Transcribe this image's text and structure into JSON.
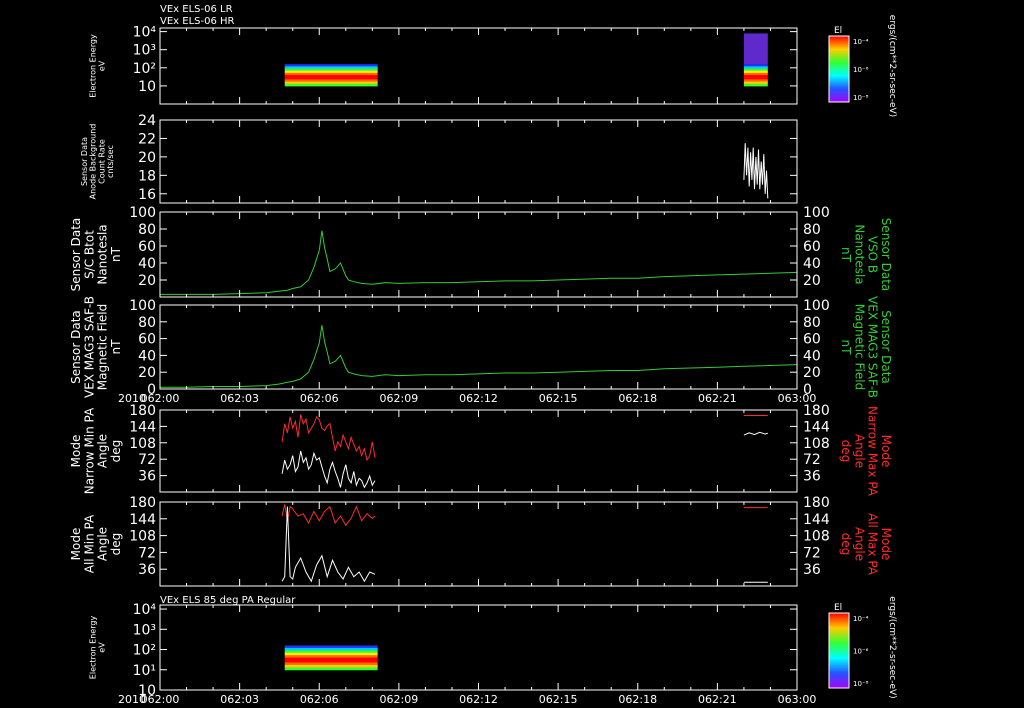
{
  "header": {
    "line1": "VEx ELS-06 LR",
    "line2": "VEx ELS-06 HR"
  },
  "colors": {
    "background": "#000000",
    "axis": "#ffffff",
    "mag": "#33cc33",
    "min_pa": "#ffffff",
    "max_pa": "#ff2a2a"
  },
  "time_axis": {
    "year": "2010",
    "ticks": [
      "062:00",
      "062:03",
      "062:06",
      "062:09",
      "062:12",
      "062:15",
      "062:18",
      "062:21",
      "063:00"
    ],
    "tick_minutes": [
      0,
      3,
      6,
      9,
      12,
      15,
      18,
      21,
      24
    ],
    "range_minutes": [
      0,
      24
    ]
  },
  "chart_data": [
    {
      "type": "heatmap",
      "id": "els_lr_hr",
      "ylabel": [
        "Electron Energy",
        "eV"
      ],
      "ytick_labels": [
        "10",
        "10²",
        "10³",
        "10⁴"
      ],
      "yticks_log10": [
        1,
        2,
        3,
        4
      ],
      "ylim_log10": [
        0,
        4.2
      ],
      "x_extent_minutes": [
        [
          4.7,
          8.2
        ],
        [
          22.0,
          22.9
        ]
      ],
      "colorbar": {
        "title": "El",
        "labels": [
          "10⁻⁴",
          "10⁻⁶",
          "10⁻⁸"
        ],
        "units": "ergs/(cm**2-sr-sec-eV)"
      }
    },
    {
      "type": "line",
      "id": "anode_bkg",
      "ylabel": [
        "Sensor Data",
        "Anode Background",
        "Count Rate",
        "cnts/sec"
      ],
      "yticks": [
        16,
        18,
        20,
        22,
        24
      ],
      "ylim": [
        15,
        24
      ],
      "series": [
        {
          "color": "#ffffff",
          "x": [
            22.0,
            22.05,
            22.1,
            22.15,
            22.2,
            22.25,
            22.3,
            22.35,
            22.4,
            22.45,
            22.5,
            22.55,
            22.6,
            22.65,
            22.7,
            22.75,
            22.8,
            22.85,
            22.9
          ],
          "y": [
            17.5,
            21.5,
            18.0,
            21.0,
            16.8,
            20.5,
            17.5,
            21.0,
            16.5,
            20.0,
            17.0,
            20.8,
            16.5,
            19.5,
            17.0,
            20.3,
            16.0,
            18.5,
            15.5
          ]
        }
      ]
    },
    {
      "type": "line",
      "id": "btot",
      "ylabel": [
        "Sensor Data",
        "S/C Btot",
        "Nanotesla",
        "nT"
      ],
      "ylabel_right": [
        "Sensor Data",
        "VSO B",
        "Nanotesla",
        "nT"
      ],
      "yticks": [
        20,
        40,
        60,
        80,
        100
      ],
      "ylim": [
        0,
        100
      ],
      "series": [
        {
          "color": "#33cc33",
          "x": [
            0,
            1,
            2,
            3,
            4,
            4.5,
            4.8,
            5.0,
            5.3,
            5.6,
            5.8,
            6.0,
            6.1,
            6.2,
            6.3,
            6.4,
            6.6,
            6.8,
            7.0,
            7.1,
            7.3,
            7.6,
            8.0,
            8.5,
            9,
            10,
            11,
            12,
            13,
            14,
            15,
            16,
            17,
            18,
            19,
            20,
            21,
            22,
            23,
            24
          ],
          "y": [
            3,
            3,
            3,
            4,
            5,
            7,
            8,
            10,
            12,
            20,
            35,
            55,
            78,
            58,
            45,
            30,
            33,
            40,
            25,
            20,
            18,
            16,
            15,
            17,
            16,
            17,
            17,
            18,
            19,
            19,
            20,
            21,
            22,
            22,
            24,
            25,
            26,
            27,
            28,
            29
          ]
        }
      ]
    },
    {
      "type": "line",
      "id": "mag_saf",
      "ylabel": [
        "Sensor Data",
        "VEX MAG3 SAF-B",
        "Magnetic Field",
        "nT"
      ],
      "ylabel_right": [
        "Sensor Data",
        "VEX MAG3 SAF-B",
        "Magnetic Field",
        "nT"
      ],
      "yticks": [
        0,
        20,
        40,
        60,
        80,
        100
      ],
      "ylim": [
        0,
        100
      ],
      "series": [
        {
          "color": "#33cc33",
          "x": [
            0,
            1,
            2,
            3,
            4,
            4.5,
            4.8,
            5.0,
            5.3,
            5.6,
            5.8,
            6.0,
            6.1,
            6.2,
            6.3,
            6.4,
            6.6,
            6.8,
            7.0,
            7.1,
            7.3,
            7.6,
            8.0,
            8.5,
            9,
            10,
            11,
            12,
            13,
            14,
            15,
            16,
            17,
            18,
            19,
            20,
            21,
            22,
            23,
            24
          ],
          "y": [
            2,
            2,
            3,
            3,
            4,
            6,
            8,
            9,
            12,
            20,
            35,
            55,
            76,
            56,
            44,
            30,
            33,
            40,
            25,
            20,
            18,
            16,
            15,
            17,
            16,
            17,
            17,
            18,
            19,
            19,
            20,
            21,
            22,
            22,
            24,
            25,
            26,
            27,
            28,
            29
          ]
        }
      ]
    },
    {
      "type": "line",
      "id": "narrow_pa",
      "ylabel": [
        "Mode",
        "Narrow Min PA",
        "Angle",
        "deg"
      ],
      "ylabel_right": [
        "Mode",
        "Narrow Max PA",
        "Angle",
        "deg"
      ],
      "yticks": [
        36,
        72,
        108,
        144,
        180
      ],
      "ylim": [
        0,
        180
      ],
      "series": [
        {
          "name": "Narrow Max PA",
          "color": "#ff2a2a",
          "x": [
            4.6,
            4.7,
            4.8,
            4.9,
            5.0,
            5.1,
            5.2,
            5.3,
            5.4,
            5.5,
            5.6,
            5.7,
            5.8,
            5.9,
            6.0,
            6.1,
            6.2,
            6.3,
            6.4,
            6.5,
            6.6,
            6.7,
            6.8,
            6.9,
            7.0,
            7.1,
            7.2,
            7.3,
            7.4,
            7.5,
            7.6,
            7.7,
            7.8,
            7.9,
            8.0,
            8.1
          ],
          "y": [
            110,
            150,
            130,
            165,
            140,
            155,
            120,
            170,
            150,
            160,
            130,
            140,
            150,
            165,
            158,
            140,
            135,
            145,
            150,
            120,
            90,
            110,
            100,
            125,
            110,
            95,
            120,
            105,
            90,
            100,
            80,
            95,
            70,
            80,
            110,
            75
          ]
        },
        {
          "name": "Narrow Max PA",
          "color": "#ff2a2a",
          "x": [
            22.0,
            22.9
          ],
          "y": [
            168,
            168
          ]
        },
        {
          "name": "Narrow Min PA",
          "color": "#ffffff",
          "x": [
            4.6,
            4.7,
            4.8,
            4.9,
            5.0,
            5.1,
            5.2,
            5.3,
            5.4,
            5.5,
            5.6,
            5.7,
            5.8,
            5.9,
            6.0,
            6.1,
            6.2,
            6.3,
            6.4,
            6.5,
            6.6,
            6.7,
            6.8,
            6.9,
            7.0,
            7.1,
            7.2,
            7.3,
            7.4,
            7.5,
            7.6,
            7.7,
            7.8,
            7.9,
            8.0,
            8.1
          ],
          "y": [
            40,
            70,
            50,
            60,
            80,
            45,
            55,
            90,
            65,
            75,
            50,
            60,
            85,
            70,
            75,
            55,
            35,
            20,
            50,
            65,
            45,
            30,
            10,
            40,
            60,
            30,
            20,
            45,
            15,
            30,
            25,
            10,
            20,
            35,
            15,
            25
          ]
        },
        {
          "name": "Narrow Min PA",
          "color": "#ffffff",
          "x": [
            22.0,
            22.2,
            22.4,
            22.6,
            22.8,
            22.9
          ],
          "y": [
            125,
            130,
            126,
            131,
            127,
            129
          ]
        }
      ]
    },
    {
      "type": "line",
      "id": "all_pa",
      "ylabel": [
        "Mode",
        "All Min PA",
        "Angle",
        "deg"
      ],
      "ylabel_right": [
        "Mode",
        "All Max PA",
        "Angle",
        "deg"
      ],
      "yticks": [
        36,
        72,
        108,
        144,
        180
      ],
      "ylim": [
        0,
        180
      ],
      "series": [
        {
          "name": "All Max PA",
          "color": "#ff2a2a",
          "x": [
            4.6,
            4.7,
            4.8,
            4.9,
            5.0,
            5.2,
            5.4,
            5.6,
            5.8,
            6.0,
            6.2,
            6.4,
            6.6,
            6.8,
            7.0,
            7.2,
            7.4,
            7.6,
            7.8,
            8.0,
            8.1
          ],
          "y": [
            150,
            175,
            140,
            170,
            165,
            150,
            155,
            135,
            160,
            140,
            160,
            170,
            135,
            150,
            130,
            145,
            170,
            140,
            155,
            145,
            150
          ]
        },
        {
          "name": "All Max PA",
          "color": "#ff2a2a",
          "x": [
            22.0,
            22.9
          ],
          "y": [
            168,
            168
          ]
        },
        {
          "name": "All Min PA",
          "color": "#ffffff",
          "x": [
            4.6,
            4.7,
            4.8,
            4.9,
            5.0,
            5.1,
            5.3,
            5.5,
            5.7,
            5.9,
            6.1,
            6.3,
            6.5,
            6.7,
            6.9,
            7.1,
            7.3,
            7.5,
            7.7,
            7.9,
            8.1
          ],
          "y": [
            10,
            20,
            170,
            20,
            15,
            40,
            60,
            30,
            10,
            45,
            65,
            20,
            55,
            30,
            15,
            40,
            20,
            30,
            10,
            30,
            25
          ]
        },
        {
          "name": "All Min PA",
          "color": "#ffffff",
          "x": [
            22.0,
            22.9
          ],
          "y": [
            8,
            8
          ]
        }
      ]
    },
    {
      "type": "heatmap",
      "id": "els_85",
      "title": "VEx ELS 85 deg PA Regular",
      "ylabel": [
        "Electron Energy",
        "eV"
      ],
      "ytick_labels": [
        "10",
        "10¹",
        "10²",
        "10³",
        "10⁴"
      ],
      "yticks_log10": [
        0,
        1,
        2,
        3,
        4
      ],
      "ylim_log10": [
        0,
        4.2
      ],
      "x_extent_minutes": [
        [
          4.7,
          8.2
        ]
      ],
      "colorbar": {
        "title": "El",
        "labels": [
          "10⁻⁴",
          "10⁻⁶",
          "10⁻⁸"
        ],
        "units": "ergs/(cm**2-sr-sec-eV)"
      }
    }
  ]
}
